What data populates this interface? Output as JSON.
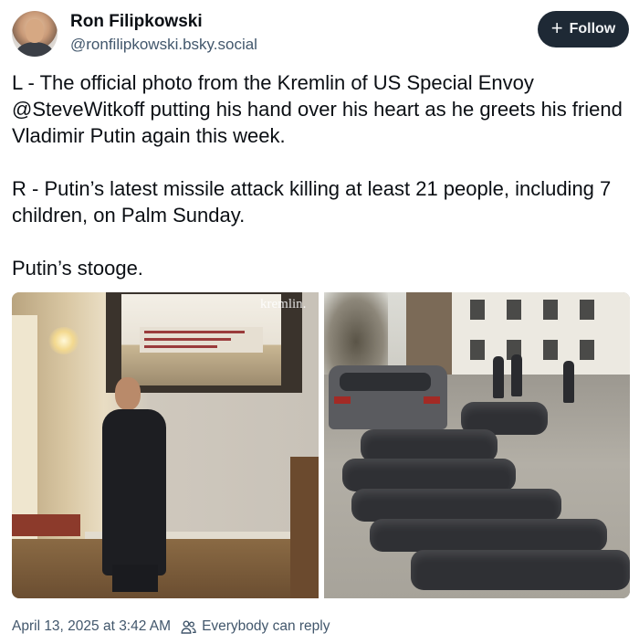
{
  "author": {
    "display_name": "Ron Filipkowski",
    "handle": "@ronfilipkowski.bsky.social",
    "avatar_icon": "person-avatar"
  },
  "follow_button": {
    "icon": "plus-icon",
    "icon_glyph": "+",
    "label": "Follow"
  },
  "post": {
    "paragraphs": [
      "L - The official photo from the Kremlin of US Special Envoy @SteveWitkoff putting his hand over his heart as he greets his friend Vladimir Putin again this week.",
      "R - Putin’s latest missile attack killing at least 21 people, including 7 children, on Palm Sunday.",
      "Putin’s stooge."
    ]
  },
  "media": {
    "left_image": {
      "subject": "man in dark suit with hand over heart in ornate room",
      "watermark": "kremlin."
    },
    "right_image": {
      "subject": "body bags on damaged street beside car"
    }
  },
  "footer": {
    "timestamp": "April 13, 2025 at 3:42 AM",
    "reply_icon": "people-icon",
    "reply_setting": "Everybody can reply"
  },
  "colors": {
    "follow_bg": "#1e2935",
    "secondary_text": "#42576c",
    "primary_text": "#0b0f14"
  }
}
